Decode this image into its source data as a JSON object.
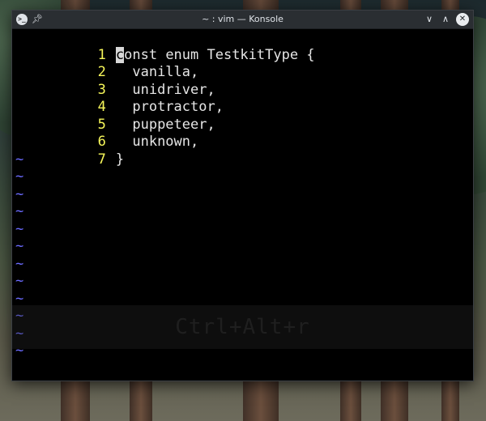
{
  "window": {
    "title": "~ : vim — Konsole",
    "app_icon": "terminal-icon",
    "pin_icon": "pin-icon",
    "minimize_icon": "chevron-down-icon",
    "maximize_icon": "chevron-up-icon",
    "close_icon": "close-icon"
  },
  "editor": {
    "lines": [
      {
        "number": "1",
        "cursor_char": "c",
        "text": "onst enum TestkitType {"
      },
      {
        "number": "2",
        "text": "  vanilla,"
      },
      {
        "number": "3",
        "text": "  unidriver,"
      },
      {
        "number": "4",
        "text": "  protractor,"
      },
      {
        "number": "5",
        "text": "  puppeteer,"
      },
      {
        "number": "6",
        "text": "  unknown,"
      },
      {
        "number": "7",
        "text": "}"
      }
    ],
    "empty_marker": "~"
  },
  "shortcut_hint": "Ctrl+Alt+r",
  "colors": {
    "line_number": "#f7f75a",
    "tilde": "#6b6bff",
    "background": "#000000",
    "text": "#e6e6e6"
  }
}
